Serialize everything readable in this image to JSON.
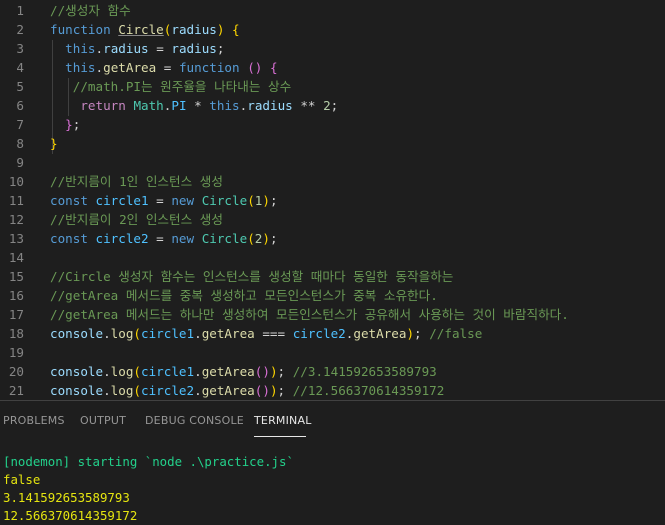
{
  "editor": {
    "lines": [
      {
        "n": "1",
        "tokens": [
          {
            "t": "//생성자 함수",
            "c": "comment"
          }
        ]
      },
      {
        "n": "2",
        "tokens": [
          {
            "t": "function",
            "c": "keyword"
          },
          {
            "t": " ",
            "c": "text"
          },
          {
            "t": "Circle",
            "c": "func",
            "u": true
          },
          {
            "t": "(",
            "c": "br1"
          },
          {
            "t": "radius",
            "c": "var"
          },
          {
            "t": ")",
            "c": "br1"
          },
          {
            "t": " ",
            "c": "text"
          },
          {
            "t": "{",
            "c": "br1"
          }
        ]
      },
      {
        "n": "3",
        "tokens": [
          {
            "t": "  ",
            "c": "text"
          },
          {
            "t": "this",
            "c": "keyword"
          },
          {
            "t": ".",
            "c": "op"
          },
          {
            "t": "radius",
            "c": "var"
          },
          {
            "t": " = ",
            "c": "op"
          },
          {
            "t": "radius",
            "c": "var"
          },
          {
            "t": ";",
            "c": "op"
          }
        ]
      },
      {
        "n": "4",
        "tokens": [
          {
            "t": "  ",
            "c": "text"
          },
          {
            "t": "this",
            "c": "keyword"
          },
          {
            "t": ".",
            "c": "op"
          },
          {
            "t": "getArea",
            "c": "func"
          },
          {
            "t": " = ",
            "c": "op"
          },
          {
            "t": "function",
            "c": "keyword"
          },
          {
            "t": " ",
            "c": "text"
          },
          {
            "t": "()",
            "c": "br2"
          },
          {
            "t": " ",
            "c": "text"
          },
          {
            "t": "{",
            "c": "br2"
          }
        ]
      },
      {
        "n": "5",
        "tokens": [
          {
            "t": "   ",
            "c": "text"
          },
          {
            "t": "//math.PI는 원주율을 나타내는 상수",
            "c": "comment"
          }
        ]
      },
      {
        "n": "6",
        "tokens": [
          {
            "t": "    ",
            "c": "text"
          },
          {
            "t": "return",
            "c": "control"
          },
          {
            "t": " ",
            "c": "text"
          },
          {
            "t": "Math",
            "c": "class"
          },
          {
            "t": ".",
            "c": "op"
          },
          {
            "t": "PI",
            "c": "const"
          },
          {
            "t": " * ",
            "c": "op"
          },
          {
            "t": "this",
            "c": "keyword"
          },
          {
            "t": ".",
            "c": "op"
          },
          {
            "t": "radius",
            "c": "var"
          },
          {
            "t": " ** ",
            "c": "op"
          },
          {
            "t": "2",
            "c": "num"
          },
          {
            "t": ";",
            "c": "op"
          }
        ]
      },
      {
        "n": "7",
        "tokens": [
          {
            "t": "  ",
            "c": "text"
          },
          {
            "t": "}",
            "c": "br2"
          },
          {
            "t": ";",
            "c": "op"
          }
        ]
      },
      {
        "n": "8",
        "tokens": [
          {
            "t": "}",
            "c": "br1"
          }
        ]
      },
      {
        "n": "9",
        "tokens": []
      },
      {
        "n": "10",
        "tokens": [
          {
            "t": "//반지름이 1인 인스턴스 생성",
            "c": "comment"
          }
        ]
      },
      {
        "n": "11",
        "tokens": [
          {
            "t": "const",
            "c": "keyword"
          },
          {
            "t": " ",
            "c": "text"
          },
          {
            "t": "circle1",
            "c": "const"
          },
          {
            "t": " = ",
            "c": "op"
          },
          {
            "t": "new",
            "c": "keyword"
          },
          {
            "t": " ",
            "c": "text"
          },
          {
            "t": "Circle",
            "c": "class"
          },
          {
            "t": "(",
            "c": "br1"
          },
          {
            "t": "1",
            "c": "num"
          },
          {
            "t": ")",
            "c": "br1"
          },
          {
            "t": ";",
            "c": "op"
          }
        ]
      },
      {
        "n": "12",
        "tokens": [
          {
            "t": "//반지름이 2인 인스턴스 생성",
            "c": "comment"
          }
        ]
      },
      {
        "n": "13",
        "tokens": [
          {
            "t": "const",
            "c": "keyword"
          },
          {
            "t": " ",
            "c": "text"
          },
          {
            "t": "circle2",
            "c": "const"
          },
          {
            "t": " = ",
            "c": "op"
          },
          {
            "t": "new",
            "c": "keyword"
          },
          {
            "t": " ",
            "c": "text"
          },
          {
            "t": "Circle",
            "c": "class"
          },
          {
            "t": "(",
            "c": "br1"
          },
          {
            "t": "2",
            "c": "num"
          },
          {
            "t": ")",
            "c": "br1"
          },
          {
            "t": ";",
            "c": "op"
          }
        ]
      },
      {
        "n": "14",
        "tokens": []
      },
      {
        "n": "15",
        "tokens": [
          {
            "t": "//Circle 생성자 함수는 인스턴스를 생성할 때마다 동일한 동작을하는",
            "c": "comment"
          }
        ]
      },
      {
        "n": "16",
        "tokens": [
          {
            "t": "//getArea 메서드를 중복 생성하고 모든인스턴스가 중복 소유한다.",
            "c": "comment"
          }
        ]
      },
      {
        "n": "17",
        "tokens": [
          {
            "t": "//getArea 메서드는 하나만 생성하여 모든인스턴스가 공유해서 사용하는 것이 바람직하다.",
            "c": "comment"
          }
        ]
      },
      {
        "n": "18",
        "tokens": [
          {
            "t": "console",
            "c": "var"
          },
          {
            "t": ".",
            "c": "op"
          },
          {
            "t": "log",
            "c": "func"
          },
          {
            "t": "(",
            "c": "br1"
          },
          {
            "t": "circle1",
            "c": "const"
          },
          {
            "t": ".",
            "c": "op"
          },
          {
            "t": "getArea",
            "c": "func"
          },
          {
            "t": " === ",
            "c": "op"
          },
          {
            "t": "circle2",
            "c": "const"
          },
          {
            "t": ".",
            "c": "op"
          },
          {
            "t": "getArea",
            "c": "func"
          },
          {
            "t": ")",
            "c": "br1"
          },
          {
            "t": "; ",
            "c": "op"
          },
          {
            "t": "//false",
            "c": "comment"
          }
        ]
      },
      {
        "n": "19",
        "tokens": []
      },
      {
        "n": "20",
        "tokens": [
          {
            "t": "console",
            "c": "var"
          },
          {
            "t": ".",
            "c": "op"
          },
          {
            "t": "log",
            "c": "func"
          },
          {
            "t": "(",
            "c": "br1"
          },
          {
            "t": "circle1",
            "c": "const"
          },
          {
            "t": ".",
            "c": "op"
          },
          {
            "t": "getArea",
            "c": "func"
          },
          {
            "t": "()",
            "c": "br2"
          },
          {
            "t": ")",
            "c": "br1"
          },
          {
            "t": "; ",
            "c": "op"
          },
          {
            "t": "//3.141592653589793",
            "c": "comment"
          }
        ]
      },
      {
        "n": "21",
        "tokens": [
          {
            "t": "console",
            "c": "var"
          },
          {
            "t": ".",
            "c": "op"
          },
          {
            "t": "log",
            "c": "func"
          },
          {
            "t": "(",
            "c": "br1"
          },
          {
            "t": "circle2",
            "c": "const"
          },
          {
            "t": ".",
            "c": "op"
          },
          {
            "t": "getArea",
            "c": "func"
          },
          {
            "t": "()",
            "c": "br2"
          },
          {
            "t": ")",
            "c": "br1"
          },
          {
            "t": "; ",
            "c": "op"
          },
          {
            "t": "//12.566370614359172",
            "c": "comment"
          }
        ]
      }
    ]
  },
  "panel": {
    "tabs": {
      "problems": "PROBLEMS",
      "output": "OUTPUT",
      "debug_console": "DEBUG CONSOLE",
      "terminal": "TERMINAL"
    },
    "terminal_lines": [
      {
        "text": "[nodemon] starting `node .\\practice.js`",
        "c": "nodemon"
      },
      {
        "text": "false",
        "c": "output"
      },
      {
        "text": "3.141592653589793",
        "c": "output"
      },
      {
        "text": "12.566370614359172",
        "c": "output"
      }
    ]
  },
  "colors": {
    "background": "#1e1e1e",
    "comment": "#6a9955",
    "keyword": "#569cd6",
    "function": "#dcdcaa",
    "variable": "#9cdcfe",
    "constant": "#4fc1ff",
    "terminal_nodemon": "#23d18b",
    "terminal_output": "#e5e510"
  }
}
